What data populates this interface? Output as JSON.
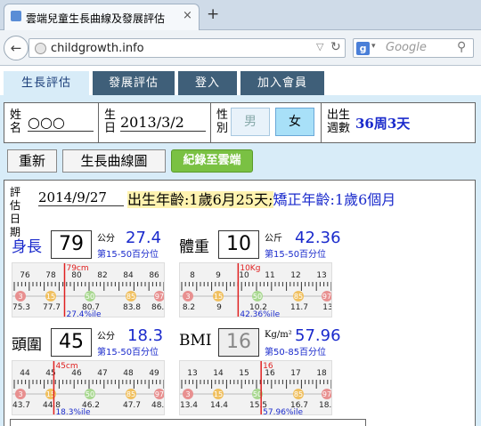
{
  "browser": {
    "tab_title": "雲端兒童生長曲線及發展評估",
    "tab_close": "×",
    "new_tab": "+",
    "back": "←",
    "url": "childgrowth.info",
    "search_placeholder": "Google",
    "search_engine_letter": "g"
  },
  "menu": [
    {
      "label": "生長評估",
      "active": true
    },
    {
      "label": "發展評估",
      "active": false
    },
    {
      "label": "登入",
      "active": false
    },
    {
      "label": "加入會員",
      "active": false
    }
  ],
  "info": {
    "name_label_1": "姓",
    "name_label_2": "名",
    "name_value": "○○○",
    "birth_label_1": "生",
    "birth_label_2": "日",
    "birth_value": "2013/3/2",
    "sex_label_1": "性",
    "sex_label_2": "別",
    "male": "男",
    "female": "女",
    "selected_sex": "female",
    "gest_label_1": "出生",
    "gest_label_2": "週數",
    "gest_value": "36周3天"
  },
  "buttons": {
    "reset": "重新",
    "curve": "生長曲線圖",
    "save": "紀錄至雲端"
  },
  "eval": {
    "date_label_1": "評估",
    "date_label_2": "日期",
    "date_value": "2014/9/27",
    "age_text": "出生年齡:1歲6月25天;",
    "corrected_text": "矯正年齡:1歲6個月"
  },
  "measures": [
    {
      "key": "length",
      "label": "身長",
      "value": "79",
      "unit": "公分",
      "percentile": "27.4",
      "range": "第15-50百分位",
      "ruler": {
        "top_ticks": [
          "76",
          "78",
          "80",
          "82",
          "84",
          "86"
        ],
        "marker_top": "79cm",
        "badges": [
          "3",
          "15",
          "50",
          "85",
          "97"
        ],
        "bottom_ticks": [
          "75.3",
          "77.7",
          "80.7",
          "83.8",
          "86.2"
        ],
        "bottom_mark": "27.4%ile",
        "marker_pos": 0.34
      }
    },
    {
      "key": "weight",
      "label": "體重",
      "value": "10",
      "unit": "公斤",
      "percentile": "42.36",
      "range": "第15-50百分位",
      "ruler": {
        "top_ticks": [
          "8",
          "9",
          "10",
          "11",
          "12",
          "13"
        ],
        "marker_top": "10Kg",
        "badges": [
          "3",
          "15",
          "50",
          "85",
          "97"
        ],
        "bottom_ticks": [
          "8.2",
          "9",
          "10.2",
          "11.7",
          "13"
        ],
        "bottom_mark": "42.36%ile",
        "marker_pos": 0.38
      }
    },
    {
      "key": "head",
      "label": "頭圍",
      "value": "45",
      "unit": "公分",
      "percentile": "18.3",
      "range": "第15-50百分位",
      "ruler": {
        "top_ticks": [
          "44",
          "45",
          "46",
          "47",
          "48",
          "49"
        ],
        "marker_top": "45cm",
        "badges": [
          "3",
          "15",
          "50",
          "85",
          "97"
        ],
        "bottom_ticks": [
          "43.7",
          "44.8",
          "46.2",
          "47.7",
          "48.8"
        ],
        "bottom_mark": "18.3%ile",
        "marker_pos": 0.27
      }
    },
    {
      "key": "bmi",
      "label": "BMI",
      "value": "16",
      "unit": "Kg/m²",
      "percentile": "57.96",
      "range": "第50-85百分位",
      "ruler": {
        "top_ticks": [
          "13",
          "14",
          "15",
          "16",
          "17",
          "18"
        ],
        "marker_top": "16",
        "badges": [
          "3",
          "15",
          "50",
          "85",
          "97"
        ],
        "bottom_ticks": [
          "13.4",
          "14.4",
          "15.5",
          "16.7",
          "18.1"
        ],
        "bottom_mark": "57.96%ile",
        "marker_pos": 0.53
      }
    }
  ],
  "colors": {
    "menu_bg": "#3f5f79",
    "page_bg": "#d8ecf8",
    "accent_blue": "#1a2acc",
    "marker_red": "#e02020",
    "save_green": "#7ac143",
    "age_highlight": "#fff3b0"
  }
}
